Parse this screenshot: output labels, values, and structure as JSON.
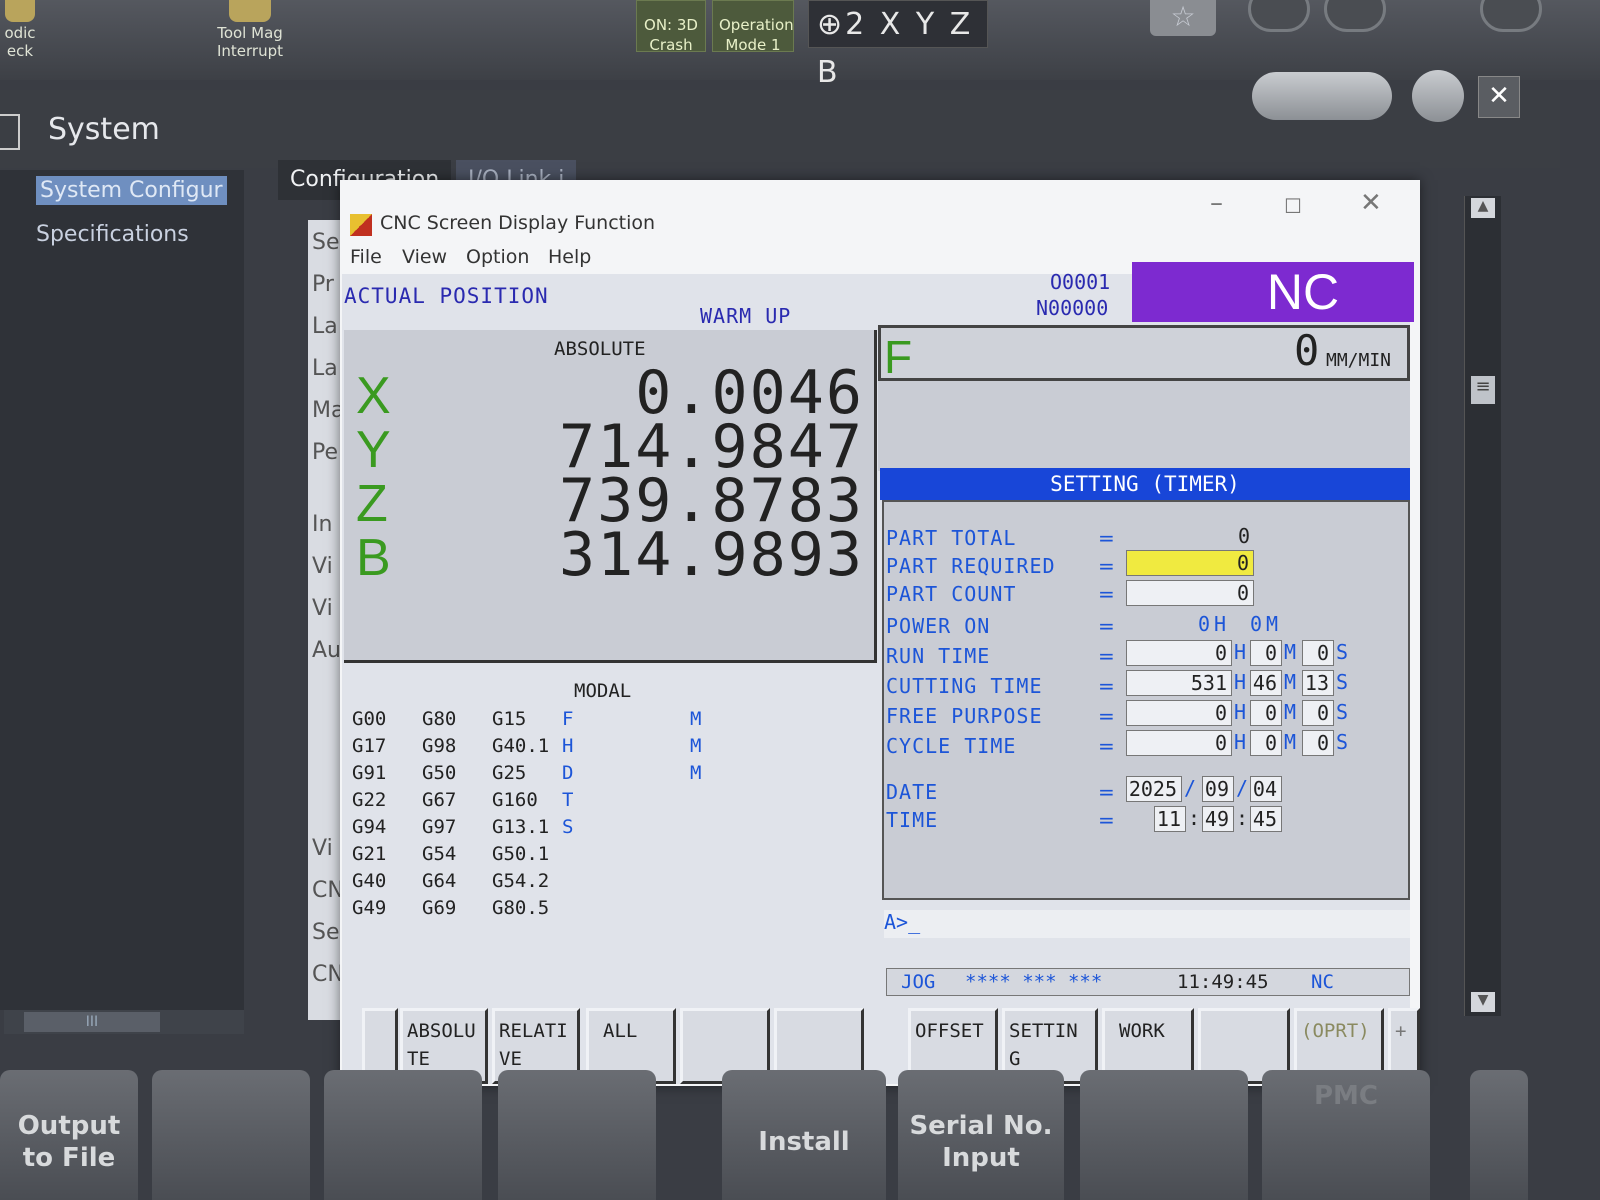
{
  "toolbar": {
    "left_label_1": "odic",
    "left_label_2": "eck",
    "tool_mag_1": "Tool Mag",
    "tool_mag_2": "Interrupt",
    "on3d_1": "ON: 3D",
    "on3d_2": "Crash",
    "op_mode_1": "Operation",
    "op_mode_2": "Mode 1",
    "axes": "2 X Y Z B"
  },
  "system": {
    "title": "System",
    "tree": [
      "System Configur",
      "Specifications"
    ],
    "tabs": [
      "Configuration",
      "I/O Link i"
    ],
    "behind_list": [
      "Se",
      "Pr",
      "La",
      "La",
      "Ma",
      "Pe",
      "In",
      "Vi",
      "Vi",
      "Au",
      "Vi",
      "CN",
      "Se",
      "CN"
    ]
  },
  "cnc_window": {
    "title": "CNC Screen Display Function",
    "menu": [
      "File",
      "View",
      "Option",
      "Help"
    ],
    "screen_title": "ACTUAL POSITION",
    "mode_text": "WARM UP",
    "program_no": "O0001",
    "sequence_no": "N00000",
    "nc_badge": "NC",
    "absolute_label": "ABSOLUTE",
    "axes": [
      {
        "letter": "X",
        "value": "0.0046"
      },
      {
        "letter": "Y",
        "value": "714.9847"
      },
      {
        "letter": "Z",
        "value": "739.8783"
      },
      {
        "letter": "B",
        "value": "314.9893"
      }
    ],
    "feed_label": "F",
    "feed_value": "0",
    "feed_unit": "MM/MIN",
    "modal_label": "MODAL",
    "modal_rows": [
      [
        "G00",
        "G80",
        "G15",
        "F",
        "M"
      ],
      [
        "G17",
        "G98",
        "G40.1",
        "H",
        "M"
      ],
      [
        "G91",
        "G50",
        "G25",
        "D",
        "M"
      ],
      [
        "G22",
        "G67",
        "G160",
        "T",
        ""
      ],
      [
        "G94",
        "G97",
        "G13.1",
        "S",
        ""
      ],
      [
        "G21",
        "G54",
        "G50.1",
        "",
        ""
      ],
      [
        "G40",
        "G64",
        "G54.2",
        "",
        ""
      ],
      [
        "G49",
        "G69",
        "G80.5",
        "",
        ""
      ]
    ],
    "timer": {
      "header": "SETTING (TIMER)",
      "part_total_label": "PART TOTAL",
      "part_total": "0",
      "part_required_label": "PART REQUIRED",
      "part_required": "0",
      "part_count_label": "PART COUNT",
      "part_count": "0",
      "power_on_label": "POWER ON",
      "power_on_h": "0",
      "power_on_m": "0",
      "run_time_label": "RUN TIME",
      "run_time": [
        "0",
        "0",
        "0"
      ],
      "cutting_time_label": "CUTTING TIME",
      "cutting_time": [
        "531",
        "46",
        "13"
      ],
      "free_purpose_label": "FREE PURPOSE",
      "free_purpose": [
        "0",
        "0",
        "0"
      ],
      "cycle_time_label": "CYCLE TIME",
      "cycle_time": [
        "0",
        "0",
        "0"
      ],
      "date_label": "DATE",
      "date": [
        "2025",
        "09",
        "04"
      ],
      "time_label": "TIME",
      "time": [
        "11",
        "49",
        "45"
      ],
      "unit_h": "H",
      "unit_m": "M",
      "unit_s": "S",
      "eq": "="
    },
    "command_prompt": "A>_",
    "status": {
      "mode": "JOG",
      "stars": "**** *** ***",
      "clock": "11:49:45",
      "nc": "NC"
    },
    "softkeys_left": [
      "",
      "ABSOLU\nTE",
      "RELATI\nVE",
      "ALL",
      "",
      ""
    ],
    "softkeys_right": [
      "OFFSET",
      "SETTIN\nG",
      "WORK",
      "",
      "(OPRT)",
      "+"
    ]
  },
  "bottom_buttons": [
    "Output\nto File",
    "",
    "",
    "",
    "Install",
    "Serial No.\nInput",
    "",
    "PMC"
  ]
}
